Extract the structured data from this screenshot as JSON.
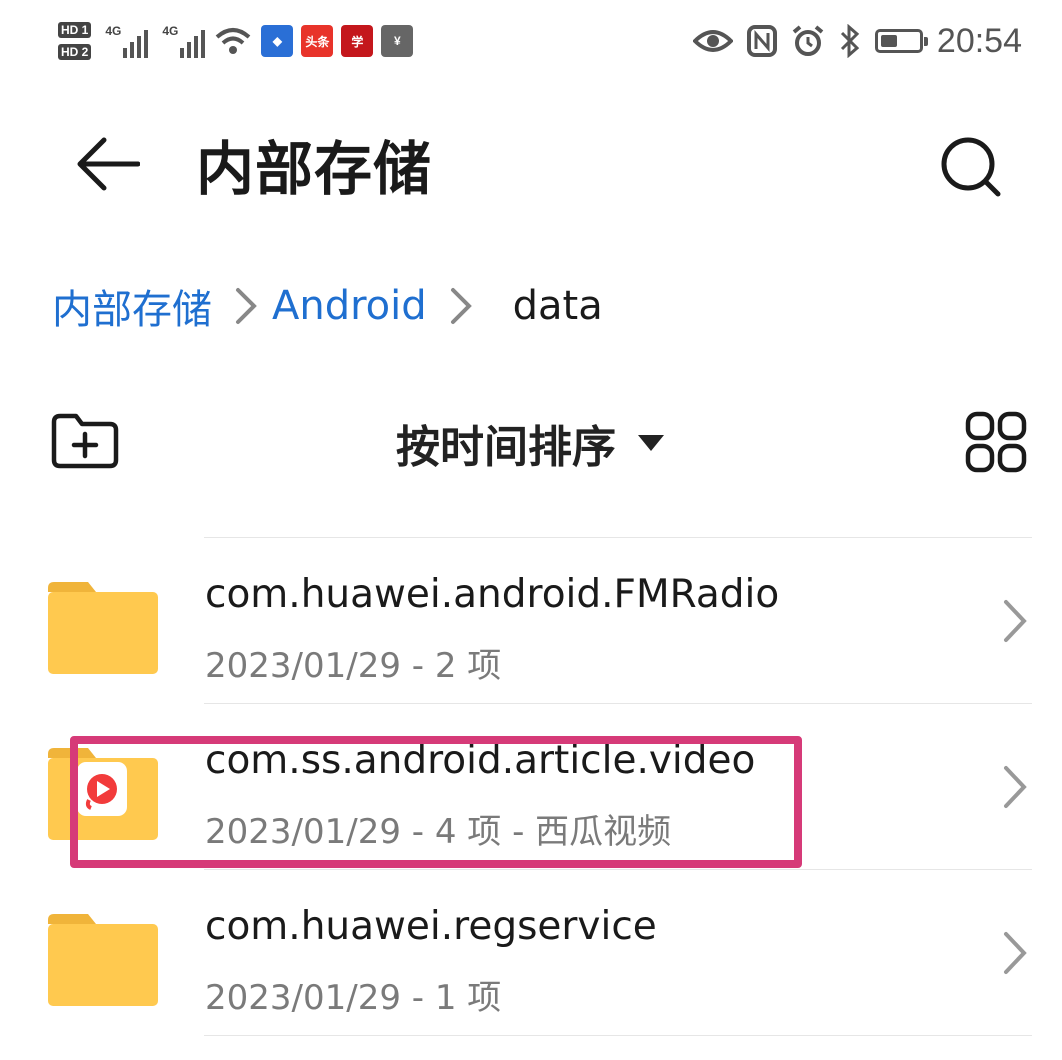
{
  "status_bar": {
    "sim1_label": "HD 1",
    "sim2_label": "HD 2",
    "network1": "4G",
    "network2": "4G",
    "app_icons": [
      "jianxin-icon",
      "toutiao-icon",
      "xuexi-icon",
      "wallet-icon"
    ],
    "toutiao_text": "头条",
    "time": "20:54"
  },
  "header": {
    "title": "内部存储"
  },
  "breadcrumb": {
    "items": [
      "内部存储",
      "Android"
    ],
    "current": "data"
  },
  "toolbar": {
    "sort_label": "按时间排序"
  },
  "files": [
    {
      "name": "com.huawei.android.FMRadio",
      "meta": "2023/01/29 - 2 项"
    },
    {
      "name": "com.ss.android.article.video",
      "meta": "2023/01/29 - 4 项 - 西瓜视频"
    },
    {
      "name": "com.huawei.regservice",
      "meta": "2023/01/29 - 1 项"
    }
  ],
  "colors": {
    "accent": "#1f6fd0",
    "folder": "#ffc44d",
    "highlight": "#d63a78"
  }
}
